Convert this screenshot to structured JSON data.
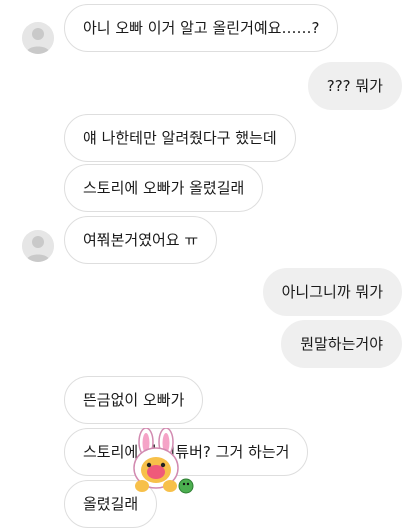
{
  "messages": [
    {
      "side": "in",
      "text": "아니 오빠 이거 알고 올린거예요……?",
      "avatar": true
    },
    {
      "side": "out",
      "text": "??? 뭐가"
    },
    {
      "side": "in",
      "text": "얘 나한테만 알려줬다구 했는데"
    },
    {
      "side": "in",
      "text": "스토리에 오빠가 올렸길래"
    },
    {
      "side": "in",
      "text": "여쭤본거였어요 ㅠ",
      "avatar": true
    },
    {
      "side": "out",
      "text": "아니그니까 뭐가"
    },
    {
      "side": "out",
      "text": "뭔말하는거야"
    },
    {
      "side": "in",
      "text": "뜬금없이 오빠가"
    },
    {
      "side": "in",
      "text": "스토리에      이 버튜버? 그거 하는거"
    },
    {
      "side": "in",
      "text": "올렸길래"
    }
  ],
  "sticker": {
    "icon": "bunny-character-sticker-icon"
  }
}
